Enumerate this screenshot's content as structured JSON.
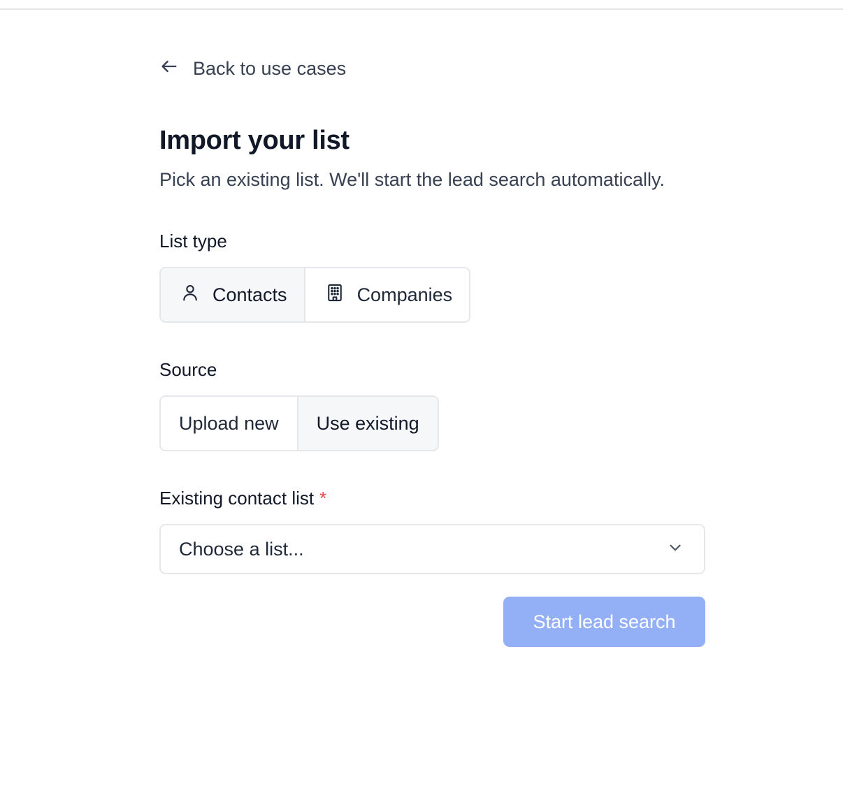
{
  "nav": {
    "back_label": "Back to use cases"
  },
  "header": {
    "title": "Import your list",
    "subtitle": "Pick an existing list. We'll start the lead search automatically."
  },
  "list_type": {
    "label": "List type",
    "options": [
      {
        "label": "Contacts",
        "icon": "user-icon",
        "selected": true
      },
      {
        "label": "Companies",
        "icon": "building-icon",
        "selected": false
      }
    ]
  },
  "source": {
    "label": "Source",
    "options": [
      {
        "label": "Upload new",
        "selected": false
      },
      {
        "label": "Use existing",
        "selected": true
      }
    ]
  },
  "existing_list": {
    "label": "Existing contact list",
    "required_marker": "*",
    "value": "Choose a list..."
  },
  "submit": {
    "label": "Start lead search",
    "disabled": true
  },
  "colors": {
    "primary_disabled": "#93aff5",
    "required": "#ef4444",
    "active_segment_bg": "#f6f7f9",
    "border": "#e5e7eb"
  }
}
